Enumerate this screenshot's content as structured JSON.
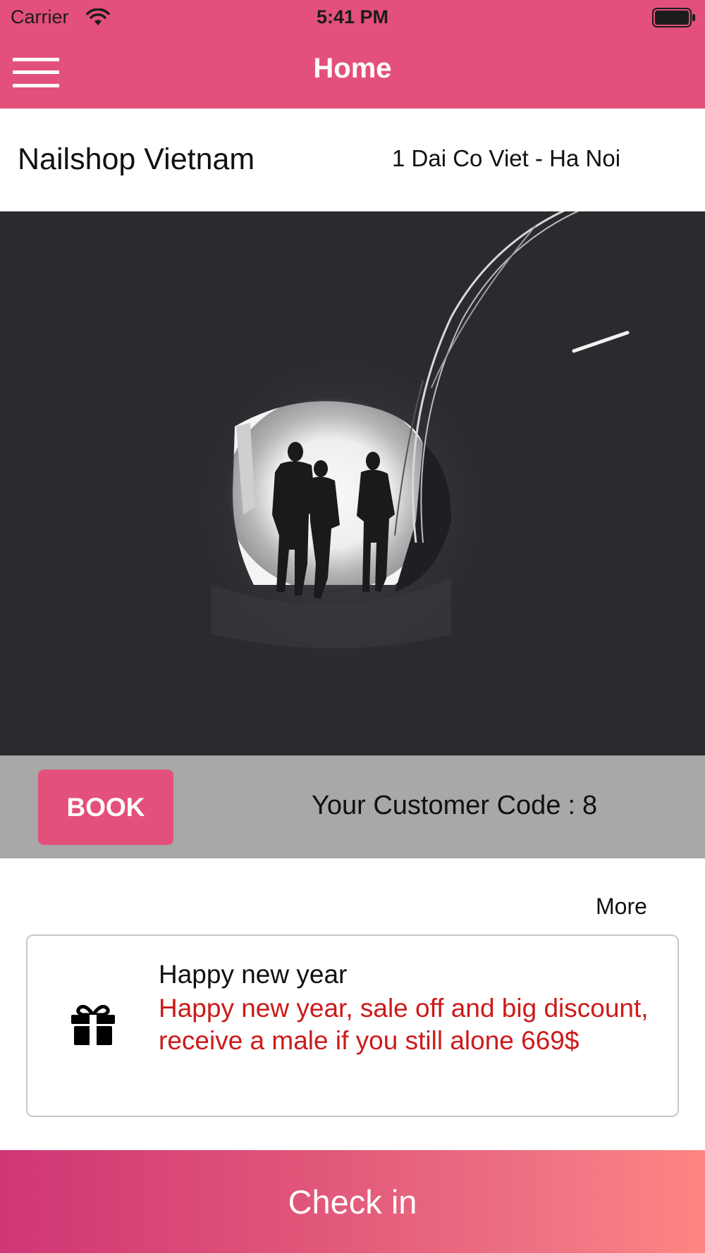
{
  "status_bar": {
    "carrier": "Carrier",
    "time": "5:41 PM",
    "wifi_icon": "wifi-icon",
    "battery_icon": "battery-icon"
  },
  "nav": {
    "title": "Home",
    "menu_icon": "hamburger-menu-icon",
    "color": "#e3507c"
  },
  "shop": {
    "name": "Nailshop Vietnam",
    "address": "1 Dai Co Viet - Ha Noi"
  },
  "hero": {
    "icon": "tunnel-photo"
  },
  "booking": {
    "book_label": "BOOK",
    "customer_code_label": "Your Customer Code",
    "customer_code_separator": ":",
    "customer_code_value": "8",
    "bar_color": "#a8a8a8"
  },
  "promotions": {
    "more_label": "More",
    "items": [
      {
        "icon": "gift-icon",
        "title": "Happy new year",
        "body": "Happy new year, sale off and big discount, receive a male if you still alone 669$",
        "body_color": "#cc1a1a"
      }
    ]
  },
  "checkin": {
    "label": "Check in",
    "gradient": [
      "#cf3675",
      "#fd8682"
    ]
  }
}
